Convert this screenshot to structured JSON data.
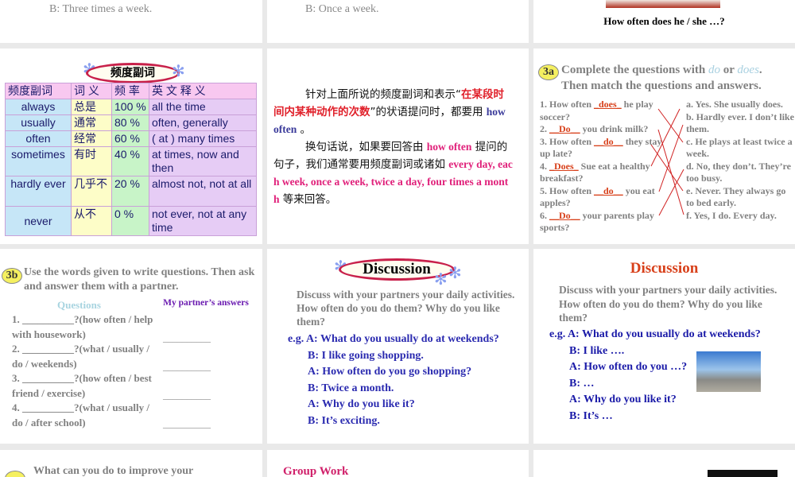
{
  "slides": {
    "top_left": {
      "text": "B: Three times a week."
    },
    "top_mid": {
      "text": "B: Once a week."
    },
    "top_right": {
      "text": "How often does he / she …?"
    },
    "freq_table": {
      "title": "频度副词",
      "headers": [
        "频度副词",
        "词 义",
        "频 率",
        "英 文 释 义"
      ],
      "rows": [
        [
          "always",
          "总是",
          "100 %",
          "all the time"
        ],
        [
          "usually",
          "通常",
          "80 %",
          "often, generally"
        ],
        [
          "often",
          "经常",
          "60 %",
          "( at ) many times"
        ],
        [
          "sometimes",
          "有时",
          "40 %",
          "at times, now and then"
        ],
        [
          "hardly ever",
          "几乎不",
          "20 %",
          "almost not, not at all"
        ],
        [
          "never",
          "从不",
          "0 %",
          "not ever, not at any time"
        ]
      ]
    },
    "explain": {
      "p1a": "针对上面所说的频度副词和表示“",
      "p1b": "在某段时间内某种动作的次数",
      "p1c": "”的状语提问时，都要用 ",
      "p1d": "how often",
      "p1e": " 。",
      "p2a": "换句话说，如果要回答由 ",
      "p2b": "how often",
      "p2c": " 提问的句子，我们通常要用频度副词或诸如 ",
      "p2d": "every day, each week, once a week, twice a day, four times a month",
      "p2e": " 等来回答。"
    },
    "ex3a": {
      "badge": "3a",
      "title1": "Complete the questions with ",
      "do": "do",
      "or": " or ",
      "does": "does",
      "title2": ".",
      "title3": "Then match the questions and answers.",
      "questions": [
        {
          "pre": "1. How often ",
          "ans": "_does_",
          "post": " he play soccer?"
        },
        {
          "pre": "2. ",
          "ans": "__Do__",
          "post": " you drink milk?"
        },
        {
          "pre": "3. How often ",
          "ans": "__do__",
          "post": " they stay up late?"
        },
        {
          "pre": "4. ",
          "ans": "_Does_",
          "post": " Sue eat a healthy breakfast?"
        },
        {
          "pre": "5. How often ",
          "ans": "__do__",
          "post": " you eat apples?"
        },
        {
          "pre": "6. ",
          "ans": "__Do__",
          "post": " your parents play sports?"
        }
      ],
      "answers": [
        "a. Yes. She usually does.",
        "b. Hardly ever. I don’t like them.",
        "c. He plays at least twice a week.",
        "d. No, they don’t. They’re too busy.",
        "e. Never. They always go to bed early.",
        "f. Yes, I do. Every day."
      ]
    },
    "ex3b": {
      "badge": "3b",
      "title": "Use the words given to write questions. Then ask and answer them with a partner.",
      "col_questions": "Questions",
      "col_partner": "My partner’s answers",
      "items": [
        "1. __________?(how often / help with housework)",
        "2. __________?(what / usually / do / weekends)",
        "3. __________?(how often / best friend / exercise)",
        "4. __________?(what / usually / do / after school)"
      ],
      "blank": "__________"
    },
    "discussion1": {
      "title": "Discussion",
      "intro": "Discuss with your partners your daily activities. How often do you do them? Why do you like them?",
      "lines": [
        "e.g. A: What do you usually do at weekends?",
        "B: I like going shopping.",
        "A: How often do you go shopping?",
        "B: Twice a month.",
        "A: Why do you like it?",
        "B: It’s exciting."
      ]
    },
    "discussion2": {
      "title": "Discussion",
      "intro": "Discuss with your partners your daily activities. How often do you do them? Why do you like them?",
      "lines": [
        "e.g. A: What do you usually do at weekends?",
        "B: I like ….",
        "A: How often do you …?",
        "B: …",
        "A: Why do you like it?",
        "B: It’s …"
      ]
    },
    "bottom_left": {
      "text": "What can you do to improve your"
    },
    "bottom_mid": {
      "text": "Group Work"
    }
  }
}
